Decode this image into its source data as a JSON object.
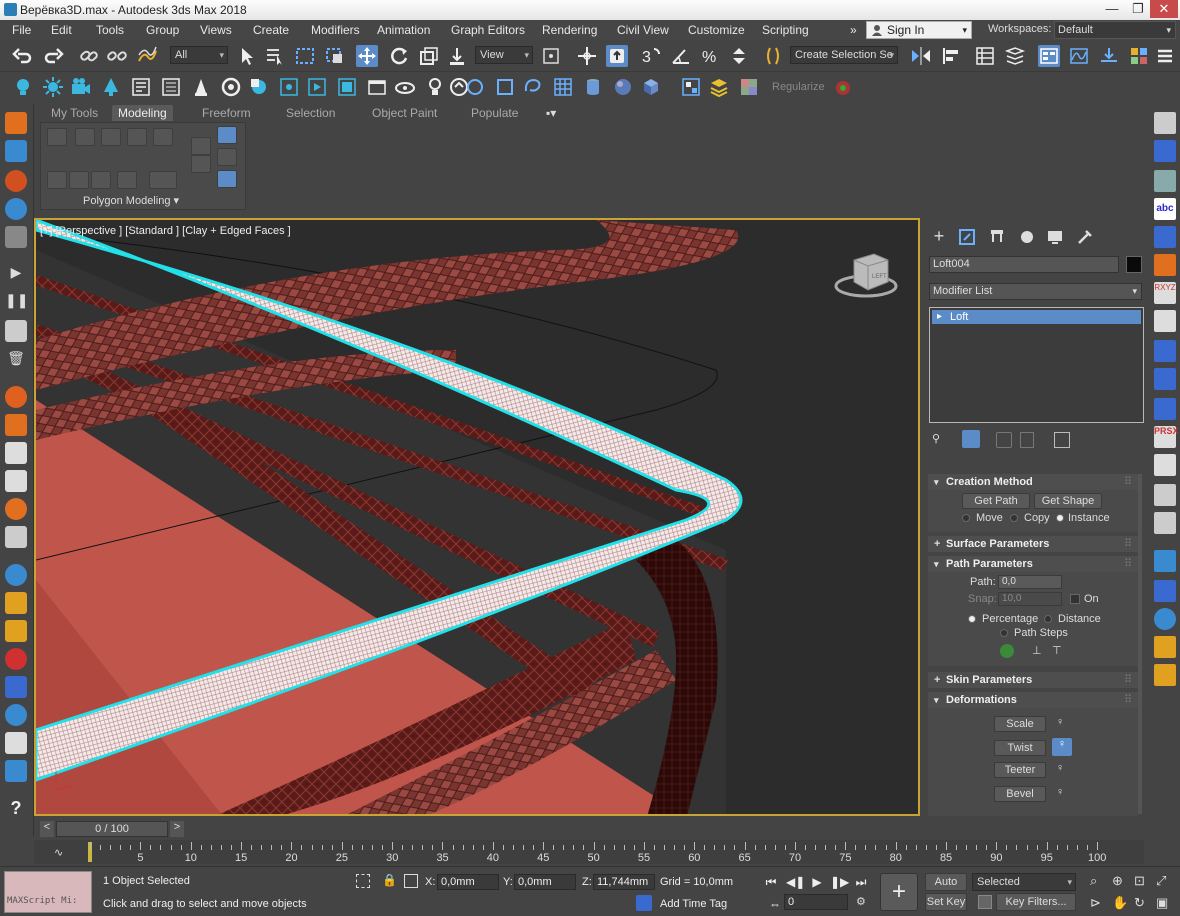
{
  "titlebar": {
    "title": "Верёвка3D.max - Autodesk 3ds Max 2018",
    "minimize": "—",
    "restore": "❐",
    "close": "✕"
  },
  "menu": [
    "File",
    "Edit",
    "Tools",
    "Group",
    "Views",
    "Create",
    "Modifiers",
    "Animation",
    "Graph Editors",
    "Rendering",
    "Civil View",
    "Customize",
    "Scripting"
  ],
  "menu_more": "»",
  "signin": "Sign In",
  "workspaces": {
    "label": "Workspaces:",
    "value": "Default"
  },
  "toolbar": {
    "filter": "All",
    "ref_coord": "View",
    "selection_set": "Create Selection Se",
    "regularize": "Regularize"
  },
  "ribbon": {
    "tabs": [
      "My Tools",
      "Modeling",
      "Freeform",
      "Selection",
      "Object Paint",
      "Populate"
    ],
    "active_tab": "Modeling",
    "label": "Polygon Modeling"
  },
  "viewport": {
    "label": "[+] [Perspective ] [Standard ] [Clay + Edged Faces ]",
    "viewcube_text": "LEFT"
  },
  "command_panel": {
    "object_name": "Loft004",
    "object_color": "#0a0a0a",
    "modifier_list": "Modifier List",
    "stack_items": [
      "Loft"
    ],
    "rollouts": {
      "creation_method": {
        "title": "Creation Method",
        "get_path": "Get Path",
        "get_shape": "Get Shape",
        "options": [
          "Move",
          "Copy",
          "Instance"
        ],
        "selected": "Instance"
      },
      "surface_parameters": {
        "title": "Surface Parameters"
      },
      "path_parameters": {
        "title": "Path Parameters",
        "path_label": "Path:",
        "path_value": "0,0",
        "snap_label": "Snap:",
        "snap_value": "10,0",
        "on_label": "On",
        "percentage": "Percentage",
        "distance": "Distance",
        "path_steps": "Path Steps"
      },
      "skin_parameters": {
        "title": "Skin Parameters"
      },
      "deformations": {
        "title": "Deformations",
        "buttons": [
          "Scale",
          "Twist",
          "Teeter",
          "Bevel"
        ]
      }
    }
  },
  "timeline": {
    "slider": "0 / 100",
    "ticks": [
      5,
      10,
      15,
      20,
      25,
      30,
      35,
      40,
      45,
      50,
      55,
      60,
      65,
      70,
      75,
      80,
      85,
      90,
      95,
      100
    ],
    "prev": "<",
    "next": ">"
  },
  "status": {
    "maxscript": "MAXScript Mi:",
    "selected": "1 Object Selected",
    "prompt": "Click and drag to select and move objects",
    "x_label": "X:",
    "x_value": "0,0mm",
    "y_label": "Y:",
    "y_value": "0,0mm",
    "z_label": "Z:",
    "z_value": "11,744mm",
    "grid": "Grid = 10,0mm",
    "add_time_tag": "Add Time Tag",
    "auto_key": "Auto Key",
    "set_key": "Set Key",
    "key_mode": "Selected",
    "key_filters": "Key Filters...",
    "frame": "0"
  },
  "colors": {
    "viewport_border": "#c8a434",
    "selection_highlight": "#5b8cc7",
    "rope": "#8a3a32",
    "floor": "#c0554c",
    "wireframe_selected": "#ffffff",
    "selection_outline": "#22e0e8"
  }
}
